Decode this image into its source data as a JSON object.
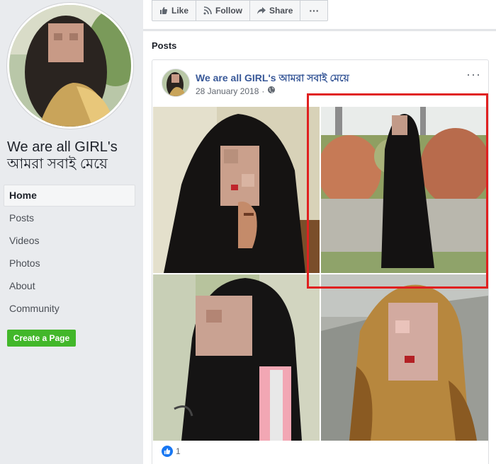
{
  "page": {
    "name": "We are all GIRL's আমরা সবাই মেয়ে"
  },
  "nav": {
    "items": [
      {
        "label": "Home",
        "active": true
      },
      {
        "label": "Posts"
      },
      {
        "label": "Videos"
      },
      {
        "label": "Photos"
      },
      {
        "label": "About"
      },
      {
        "label": "Community"
      }
    ],
    "create_page": "Create a Page"
  },
  "actions": {
    "like": "Like",
    "follow": "Follow",
    "share": "Share",
    "more": "···"
  },
  "posts": {
    "heading": "Posts",
    "post": {
      "author": "We are all GIRL's আমরা সবাই মেয়ে",
      "date": "28 January 2018",
      "separator": "·",
      "menu": "···",
      "reactions_count": "1"
    }
  },
  "colors": {
    "link": "#385898",
    "create_button": "#42b72a",
    "highlight": "#e02020",
    "like": "#1877f2"
  }
}
